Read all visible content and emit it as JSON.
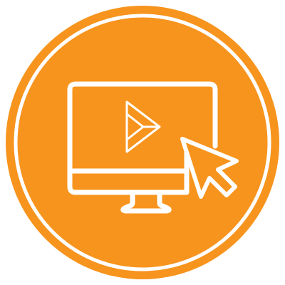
{
  "badge": {
    "fill_color": "#F7941D",
    "line_color": "#FFFFFF",
    "background_color": "#FFFFFF"
  },
  "icons": {
    "monitor": "monitor-icon",
    "logo": "play-logo-icon",
    "cursor": "cursor-arrow-icon"
  }
}
